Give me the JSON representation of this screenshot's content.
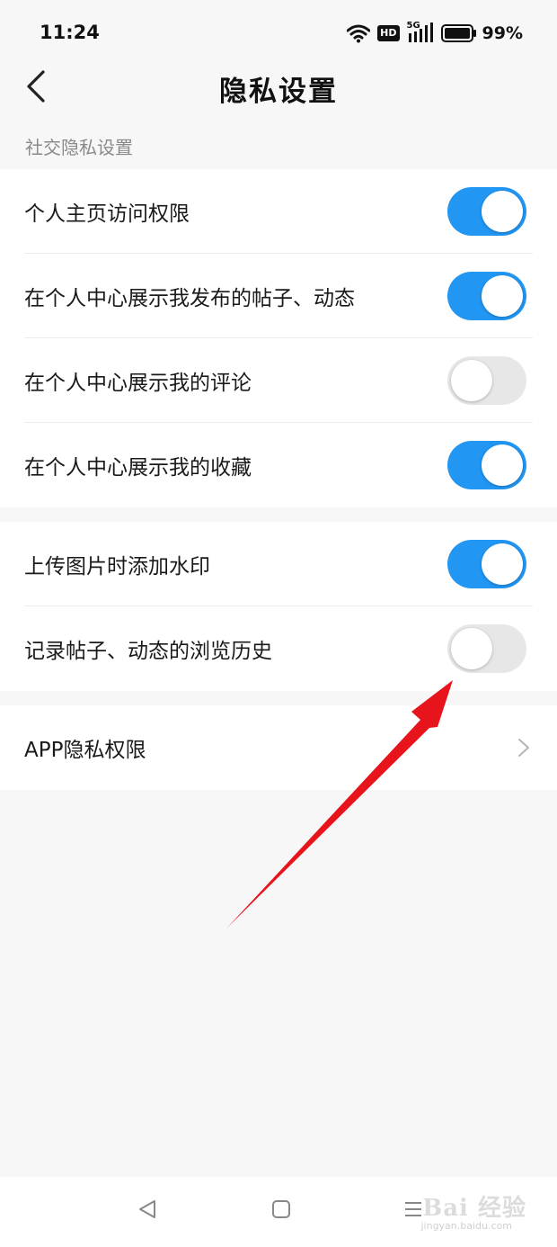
{
  "status_bar": {
    "time": "11:24",
    "hd_badge": "HD",
    "network": "5G",
    "battery_percent": "99%"
  },
  "header": {
    "title": "隐私设置"
  },
  "section": {
    "label": "社交隐私设置"
  },
  "group1": [
    {
      "label": "个人主页访问权限",
      "enabled": true
    },
    {
      "label": "在个人中心展示我发布的帖子、动态",
      "enabled": true
    },
    {
      "label": "在个人中心展示我的评论",
      "enabled": false
    },
    {
      "label": "在个人中心展示我的收藏",
      "enabled": true
    }
  ],
  "group2": [
    {
      "label": "上传图片时添加水印",
      "enabled": true
    },
    {
      "label": "记录帖子、动态的浏览历史",
      "enabled": false
    }
  ],
  "group3": {
    "app_privacy_label": "APP隐私权限"
  },
  "watermark": {
    "brand": "Bai 经验",
    "url": "jingyan.baidu.com"
  },
  "colors": {
    "toggle_on": "#2196f3",
    "toggle_off": "#e7e7e7",
    "annotation_arrow": "#e8141c"
  }
}
